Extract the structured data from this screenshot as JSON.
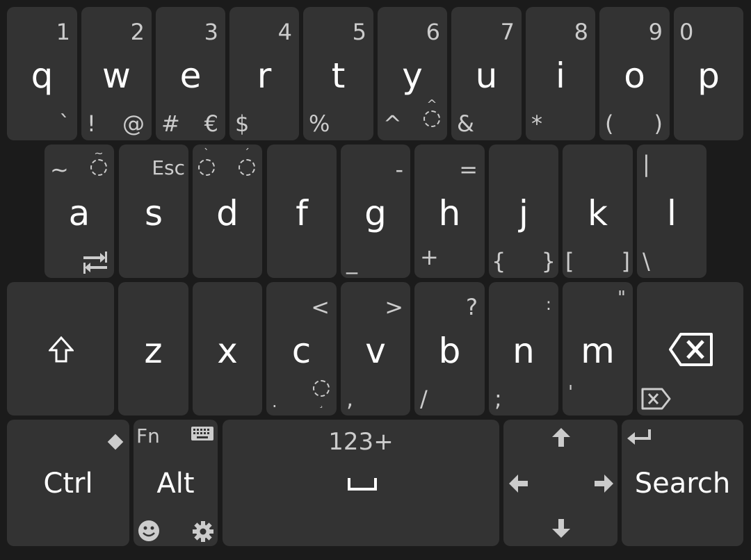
{
  "keyboard": {
    "row1": [
      {
        "main": "q",
        "tr": "1",
        "br": "`"
      },
      {
        "main": "w",
        "tr": "2",
        "bl": "!",
        "br": "@"
      },
      {
        "main": "e",
        "tr": "3",
        "bl": "#",
        "br": "€"
      },
      {
        "main": "r",
        "tr": "4",
        "bl": "$"
      },
      {
        "main": "t",
        "tr": "5",
        "bl": "%"
      },
      {
        "main": "y",
        "tr": "6",
        "bl": "^",
        "br": "◌̂"
      },
      {
        "main": "u",
        "tr": "7",
        "bl": "&"
      },
      {
        "main": "i",
        "tr": "8",
        "bl": "*"
      },
      {
        "main": "o",
        "tr": "9",
        "bl": "(",
        "br": ")"
      },
      {
        "main": "p",
        "tl": "0"
      }
    ],
    "row2": [
      {
        "main": "a",
        "tl": "~",
        "tr": "◌̃",
        "br_icon": "switch-direction-icon"
      },
      {
        "main": "s",
        "tr": "Esc"
      },
      {
        "main": "d",
        "tl": "◌̀",
        "tr": "◌́"
      },
      {
        "main": "f"
      },
      {
        "main": "g",
        "tr": "-",
        "bl": "_"
      },
      {
        "main": "h",
        "tr": "=",
        "bl": "+"
      },
      {
        "main": "j",
        "bl": "{",
        "br": "}"
      },
      {
        "main": "k",
        "bl": "[",
        "br": "]"
      },
      {
        "main": "l",
        "tl": "|",
        "bl": "\\"
      }
    ],
    "row3": [
      {
        "main": "z"
      },
      {
        "main": "x"
      },
      {
        "main": "c",
        "tr": "<",
        "bl": ".",
        "br": "◌̢"
      },
      {
        "main": "v",
        "tr": ">",
        "bl": ","
      },
      {
        "main": "b",
        "tr": "?",
        "bl": "/"
      },
      {
        "main": "n",
        "tr": ":",
        "bl": ";"
      },
      {
        "main": "m",
        "tr": "\"",
        "bl": "'"
      }
    ],
    "ctrl": {
      "label": "Ctrl",
      "tr_icon": "diamond-icon"
    },
    "alt": {
      "label": "Alt",
      "tl": "Fn"
    },
    "space": {
      "top": "123+",
      "icon": "space-bar-icon"
    },
    "search": {
      "label": "Search",
      "tl_icon": "enter-icon"
    },
    "colors": {
      "background": "#1b1b1b",
      "key": "#333333",
      "main_text": "#ffffff",
      "secondary_text": "#cccccc"
    }
  }
}
